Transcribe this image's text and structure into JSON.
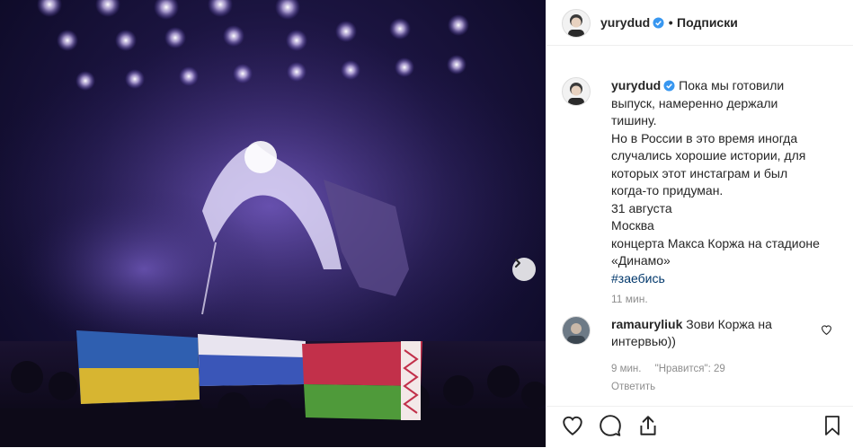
{
  "post": {
    "username": "yurydud",
    "dot": "•",
    "follow_label": "Подписки",
    "caption_lines": [
      "Пока мы готовили",
      "выпуск, намеренно держали",
      "тишину.",
      "Но в России в это время иногда",
      "случались хорошие истории, для",
      "которых этот инстаграм и был",
      "когда-то придуман.",
      "31 августа",
      "Москва",
      "концерта Макса Коржа на стадионе",
      "«Динамо»"
    ],
    "hashtag": "#заебись",
    "time": "11 мин."
  },
  "comment": {
    "username": "ramauryliuk",
    "text": "Зови Коржа на интервью))",
    "time": "9 мин.",
    "likes": "\"Нравится\": 29",
    "reply_label": "Ответить"
  },
  "colors": {
    "verified": "#3897f0",
    "hashtag": "#00376b",
    "muted": "#8e8e8e",
    "flag_ukraine_blue": "#2f5fb0",
    "flag_ukraine_yellow": "#d7b531",
    "flag_belarus_red": "#c2304a",
    "flag_belarus_green": "#4f9a3a"
  },
  "icons": [
    "chevron-right-icon",
    "verified-icon",
    "heart-icon",
    "comment-icon",
    "share-icon",
    "bookmark-icon"
  ]
}
